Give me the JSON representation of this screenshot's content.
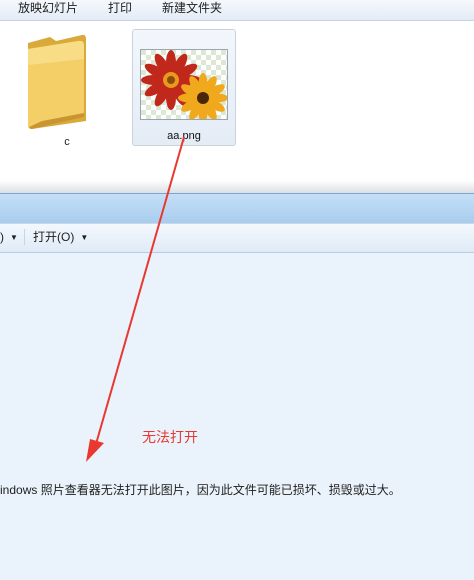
{
  "explorer": {
    "toolbar": {
      "slideshow": "放映幻灯片",
      "print": "打印",
      "new_folder": "新建文件夹"
    },
    "files": [
      {
        "name": "c",
        "icon": "folder-icon"
      },
      {
        "name": "aa.png",
        "icon": "image-thumbnail"
      }
    ]
  },
  "viewer": {
    "menu": {
      "prev_fragment": ")",
      "open": "打开(O)"
    },
    "error_message": "indows 照片查看器无法打开此图片，因为此文件可能已损坏、损毁或过大。"
  },
  "annotation": {
    "text": "无法打开",
    "color": "#e8382f"
  },
  "colors": {
    "folder": "#f2c85a",
    "viewer_background": "#eaf3fb",
    "title_bar": "#b6d6f2"
  }
}
